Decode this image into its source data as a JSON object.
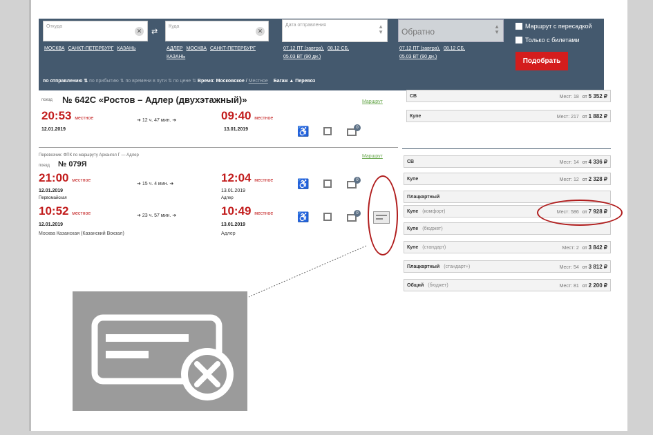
{
  "search": {
    "from_placeholder": "Откуда",
    "from_links": [
      "МОСКВА",
      "САНКТ-ПЕТЕРБУРГ",
      "КАЗАНЬ"
    ],
    "to_placeholder": "Куда",
    "to_links": [
      "АДЛЕР",
      "МОСКВА",
      "САНКТ-ПЕТЕРБУРГ",
      "КАЗАНЬ"
    ],
    "date_placeholder": "Дата отправления",
    "date_links": [
      "07.12 ПТ (завтра),",
      "08.12 СБ,",
      "05.03 ВТ (90 дн.)"
    ],
    "return_label": "Обратно",
    "return_links": [
      "07.12 ПТ (завтра),",
      "08.12 СБ,",
      "05.03 ВТ (90 дн.)"
    ],
    "check_transfer": "Маршрут с пересадкой",
    "check_tickets": "Только с билетами",
    "find_button": "Подобрать"
  },
  "sort": {
    "by_departure": "по отправлению",
    "by_arrival": "по прибытию",
    "by_travel_time": "по времени в пути",
    "by_price": "по цене",
    "time_label": "Время:",
    "time_moscow": "Московское",
    "time_local": "Местное",
    "baggage": "Багаж",
    "carrier": "Перевоз"
  },
  "train1": {
    "label": "поезд",
    "name": "№ 642С «Ростов – Адлер (двухэтажный)»",
    "route_link": "Маршрут",
    "dep_time": "20:53",
    "dep_suffix": "местное",
    "dep_date": "12.01.2019",
    "duration": "12 ч. 47 мин.",
    "arr_time": "09:40",
    "arr_suffix": "местное",
    "arr_date": "13.01.2019",
    "badge": "0"
  },
  "train2": {
    "carrier_line": "Перевозчик: ФПК по маршруту Архангел Г — Адлер",
    "label": "поезд",
    "name": "№ 079Я",
    "route_link": "Маршрут",
    "dep_time": "21:00",
    "dep_suffix": "местное",
    "dep_date": "12.01.2019",
    "duration": "15 ч. 4 мин.",
    "arr_time": "12:04",
    "arr_suffix": "местное",
    "arr_date": "13.01.2019",
    "dep_station": "Первомайская",
    "arr_station": "Адлер",
    "badge": "0"
  },
  "train3": {
    "dep_time": "10:52",
    "dep_suffix": "местное",
    "dep_date": "12.01.2019",
    "duration": "23 ч. 57 мин.",
    "arr_time": "10:49",
    "arr_suffix": "местное",
    "arr_date": "13.01.2019",
    "dep_station": "Москва Казанская (Казанский Вокзал)",
    "arr_station": "Адлер",
    "badge": "0"
  },
  "prices1": [
    {
      "cls": "СВ",
      "sub": "",
      "seats": "Мест: 18",
      "from": "от",
      "price": "5 352 ₽"
    },
    {
      "cls": "Купе",
      "sub": "",
      "seats": "Мест: 217",
      "from": "от",
      "price": "1 882 ₽"
    }
  ],
  "prices2": [
    {
      "cls": "СВ",
      "sub": "",
      "seats": "Мест: 14",
      "from": "от",
      "price": "4 336 ₽"
    },
    {
      "cls": "Купе",
      "sub": "",
      "seats": "Мест: 12",
      "from": "от",
      "price": "2 328 ₽"
    },
    {
      "cls": "Плацкартный",
      "sub": "",
      "seats": "",
      "from": "",
      "price": ""
    },
    {
      "cls": "Купе",
      "sub": "(комфорт)",
      "seats": "Мест: 586",
      "from": "от",
      "price": "7 928 ₽"
    },
    {
      "cls": "Купе",
      "sub": "(бюджет)",
      "seats": "",
      "from": "",
      "price": ""
    },
    {
      "cls": "Купе",
      "sub": "(стандарт)",
      "seats": "Мест: 2",
      "from": "от",
      "price": "3 842 ₽"
    },
    {
      "cls": "Плацкартный",
      "sub": "(стандарт+)",
      "seats": "Мест: 54",
      "from": "от",
      "price": "3 812 ₽"
    },
    {
      "cls": "Общий",
      "sub": "(бюджет)",
      "seats": "Мест: 81",
      "from": "от",
      "price": "2 200 ₽"
    }
  ]
}
